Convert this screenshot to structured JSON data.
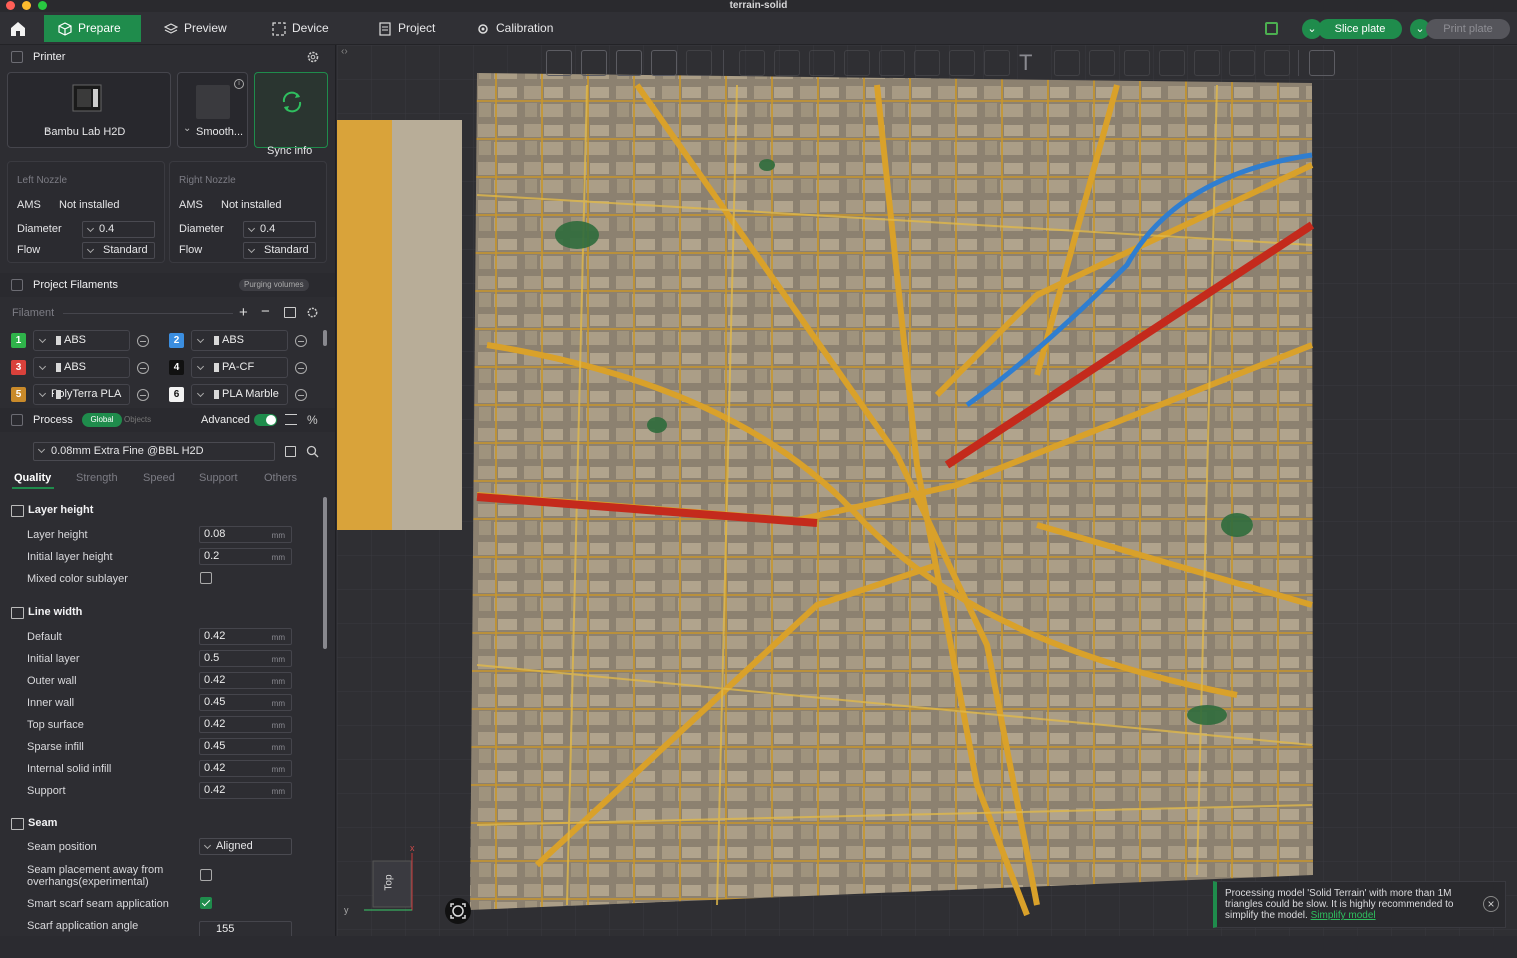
{
  "window": {
    "title": "terrain-solid"
  },
  "menu": {
    "tabs": [
      {
        "label": "Prepare"
      },
      {
        "label": "Preview"
      },
      {
        "label": "Device"
      },
      {
        "label": "Project"
      },
      {
        "label": "Calibration"
      }
    ],
    "slice_label": "Slice plate",
    "print_label": "Print plate"
  },
  "printer": {
    "section": "Printer",
    "model": "Bambu Lab H2D",
    "plate": "Smooth...",
    "sync": "Sync info"
  },
  "nozzles": {
    "left": {
      "title": "Left Nozzle",
      "ams_label": "AMS",
      "ams_value": "Not installed",
      "diameter_label": "Diameter",
      "diameter": "0.4",
      "flow_label": "Flow",
      "flow": "Standard"
    },
    "right": {
      "title": "Right Nozzle",
      "ams_label": "AMS",
      "ams_value": "Not installed",
      "diameter_label": "Diameter",
      "diameter": "0.4",
      "flow_label": "Flow",
      "flow": "Standard"
    }
  },
  "filaments": {
    "section": "Project Filaments",
    "purge": "Purging volumes",
    "label": "Filament",
    "items": [
      {
        "num": "1",
        "name": "ABS",
        "color": "#2fb34a"
      },
      {
        "num": "2",
        "name": "ABS",
        "color": "#3b8ee0"
      },
      {
        "num": "3",
        "name": "ABS",
        "color": "#d9413b"
      },
      {
        "num": "4",
        "name": "PA-CF",
        "color": "#111111"
      },
      {
        "num": "5",
        "name": "PolyTerra PLA",
        "color": "#c98a2a"
      },
      {
        "num": "6",
        "name": "PLA Marble",
        "color": "#f2f2f2"
      }
    ]
  },
  "process": {
    "section": "Process",
    "global": "Global",
    "objects": "Objects",
    "advanced": "Advanced",
    "preset": "0.08mm Extra Fine @BBL H2D",
    "tabs": [
      "Quality",
      "Strength",
      "Speed",
      "Support",
      "Others"
    ]
  },
  "quality": {
    "layer_height": {
      "title": "Layer height",
      "rows": [
        {
          "label": "Layer height",
          "value": "0.08",
          "unit": "mm"
        },
        {
          "label": "Initial layer height",
          "value": "0.2",
          "unit": "mm"
        }
      ],
      "mixed_label": "Mixed color sublayer"
    },
    "line_width": {
      "title": "Line width",
      "rows": [
        {
          "label": "Default",
          "value": "0.42",
          "unit": "mm"
        },
        {
          "label": "Initial layer",
          "value": "0.5",
          "unit": "mm"
        },
        {
          "label": "Outer wall",
          "value": "0.42",
          "unit": "mm"
        },
        {
          "label": "Inner wall",
          "value": "0.45",
          "unit": "mm"
        },
        {
          "label": "Top surface",
          "value": "0.42",
          "unit": "mm"
        },
        {
          "label": "Sparse infill",
          "value": "0.45",
          "unit": "mm"
        },
        {
          "label": "Internal solid infill",
          "value": "0.42",
          "unit": "mm"
        },
        {
          "label": "Support",
          "value": "0.42",
          "unit": "mm"
        }
      ]
    },
    "seam": {
      "title": "Seam",
      "position_label": "Seam position",
      "position": "Aligned",
      "overhang_label": "Seam placement away from overhangs(experimental)",
      "scarf_label": "Smart scarf seam application",
      "angle_label": "Scarf application angle",
      "angle": "155"
    }
  },
  "viewport": {
    "axis_x": "x",
    "axis_y": "y",
    "view_label": "Top"
  },
  "toast": {
    "message": "Processing model 'Solid Terrain' with more than 1M triangles could be slow. It is highly recommended to simplify the model.",
    "link": "Simplify model"
  }
}
